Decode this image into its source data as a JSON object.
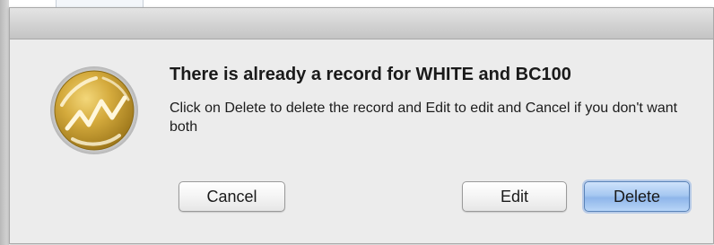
{
  "dialog": {
    "heading": "There is already a record for WHITE and BC100",
    "message": "Click on Delete to delete the record and Edit to edit and Cancel if you don't want both",
    "icon": "app-icon",
    "buttons": {
      "cancel_label": "Cancel",
      "edit_label": "Edit",
      "delete_label": "Delete",
      "default_button": "Delete"
    }
  },
  "colors": {
    "dialog_background": "#ececec",
    "default_button_accent": "#8fb6ea",
    "icon_gold": "#c9a232"
  }
}
